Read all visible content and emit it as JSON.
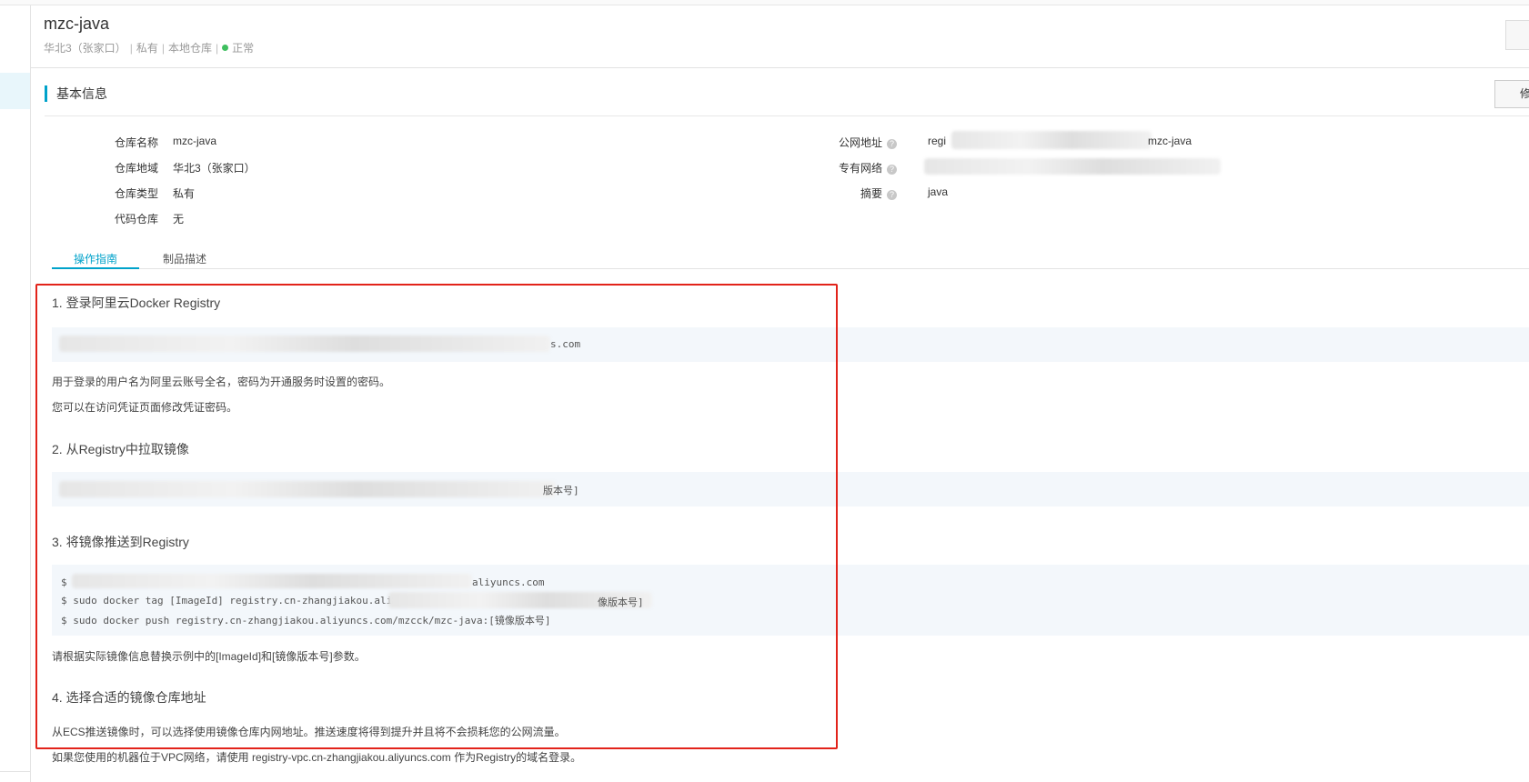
{
  "repo": {
    "title": "mzc-java",
    "region": "华北3（张家口）",
    "visibility": "私有",
    "source": "本地仓库",
    "status": "正常"
  },
  "section": {
    "title": "基本信息",
    "edit_label": "修改信息"
  },
  "info_left": [
    {
      "label": "仓库名称",
      "value": "mzc-java"
    },
    {
      "label": "仓库地域",
      "value": "华北3（张家口）"
    },
    {
      "label": "仓库类型",
      "value": "私有"
    },
    {
      "label": "代码仓库",
      "value": "无"
    }
  ],
  "info_right": [
    {
      "label": "公网地址",
      "value_prefix": "regi",
      "value_suffix": "mzc-java"
    },
    {
      "label": "专有网络",
      "value_prefix": "",
      "value_suffix": ""
    },
    {
      "label": "摘要",
      "value_prefix": "java",
      "value_suffix": ""
    }
  ],
  "tabs": [
    {
      "label": "操作指南",
      "active": true
    },
    {
      "label": "制品描述",
      "active": false
    }
  ],
  "guide": {
    "step1_title": "1. 登录阿里云Docker Registry",
    "step1_code_tail": "s.com",
    "step1_note1": "用于登录的用户名为阿里云账号全名，密码为开通服务时设置的密码。",
    "step1_note2": "您可以在访问凭证页面修改凭证密码。",
    "step2_title": "2. 从Registry中拉取镜像",
    "step2_code_tail": "版本号]",
    "step3_title": "3. 将镜像推送到Registry",
    "step3_line1_head": "$",
    "step3_line1_tail": "aliyuncs.com",
    "step3_line2": "$ sudo docker tag [ImageId] registry.cn-zhangjiakou.aliyunc",
    "step3_line2_tail": "像版本号]",
    "step3_line3": "$ sudo docker push registry.cn-zhangjiakou.aliyuncs.com/mzcck/mzc-java:[镜像版本号]",
    "step3_note": "请根据实际镜像信息替换示例中的[ImageId]和[镜像版本号]参数。",
    "step4_title": "4. 选择合适的镜像仓库地址",
    "step4_note1": "从ECS推送镜像时，可以选择使用镜像仓库内网地址。推送速度将得到提升并且将不会损耗您的公网流量。",
    "step4_note2": "如果您使用的机器位于VPC网络，请使用 registry-vpc.cn-zhangjiakou.aliyuncs.com 作为Registry的域名登录。"
  },
  "colors": {
    "accent": "#00a2ca",
    "highlight_box": "#e2231a",
    "status_ok": "#3fbf5f",
    "code_bg": "#f3f7fb"
  }
}
